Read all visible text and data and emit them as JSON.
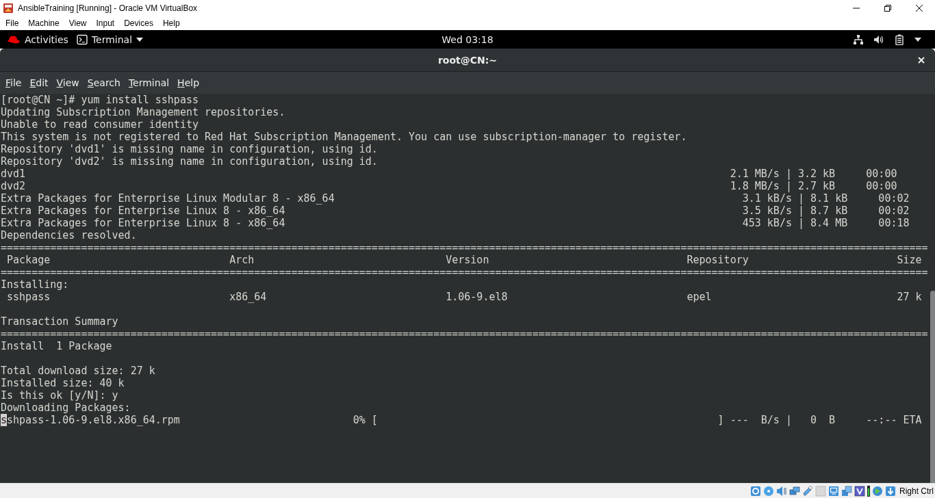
{
  "vm_window": {
    "title": "AnsibleTraining [Running] - Oracle VM VirtualBox",
    "menu": [
      "File",
      "Machine",
      "View",
      "Input",
      "Devices",
      "Help"
    ]
  },
  "top_bar": {
    "activities": "Activities",
    "app_menu": "Terminal",
    "clock": "Wed 03:18"
  },
  "terminal": {
    "title": "root@CN:~",
    "menu": [
      "File",
      "Edit",
      "View",
      "Search",
      "Terminal",
      "Help"
    ],
    "lines": [
      {
        "kind": "text",
        "text": "[root@CN ~]# yum install sshpass",
        "cursor": false
      },
      {
        "kind": "text",
        "text": "Updating Subscription Management repositories.",
        "cursor": false
      },
      {
        "kind": "text",
        "text": "Unable to read consumer identity",
        "cursor": false
      },
      {
        "kind": "text",
        "text": "This system is not registered to Red Hat Subscription Management. You can use subscription-manager to register.",
        "cursor": false
      },
      {
        "kind": "text",
        "text": "Repository 'dvd1' is missing name in configuration, using id.",
        "cursor": false
      },
      {
        "kind": "text",
        "text": "Repository 'dvd2' is missing name in configuration, using id.",
        "cursor": false
      },
      {
        "kind": "text",
        "text": "dvd1                                                                                                                  2.1 MB/s | 3.2 kB     00:00",
        "cursor": false
      },
      {
        "kind": "text",
        "text": "dvd2                                                                                                                  1.8 MB/s | 2.7 kB     00:00",
        "cursor": false
      },
      {
        "kind": "text",
        "text": "Extra Packages for Enterprise Linux Modular 8 - x86_64                                                                  3.1 kB/s | 8.1 kB     00:02",
        "cursor": false
      },
      {
        "kind": "text",
        "text": "Extra Packages for Enterprise Linux 8 - x86_64                                                                          3.5 kB/s | 8.7 kB     00:02",
        "cursor": false
      },
      {
        "kind": "text",
        "text": "Extra Packages for Enterprise Linux 8 - x86_64                                                                          453 kB/s | 8.4 MB     00:18",
        "cursor": false
      },
      {
        "kind": "text",
        "text": "Dependencies resolved.",
        "cursor": false
      },
      {
        "kind": "text",
        "text": "======================================================================================================================================================",
        "cursor": false
      },
      {
        "kind": "text",
        "text": " Package                             Arch                               Version                                Repository                        Size",
        "cursor": false
      },
      {
        "kind": "text",
        "text": "======================================================================================================================================================",
        "cursor": false
      },
      {
        "kind": "text",
        "text": "Installing:",
        "cursor": false
      },
      {
        "kind": "text",
        "text": " sshpass                             x86_64                             1.06-9.el8                             epel                              27 k",
        "cursor": false
      },
      {
        "kind": "blank",
        "cursor": false
      },
      {
        "kind": "text",
        "text": "Transaction Summary",
        "cursor": false
      },
      {
        "kind": "text",
        "text": "======================================================================================================================================================",
        "cursor": false
      },
      {
        "kind": "text",
        "text": "Install  1 Package",
        "cursor": false
      },
      {
        "kind": "blank",
        "cursor": false
      },
      {
        "kind": "text",
        "text": "Total download size: 27 k",
        "cursor": false
      },
      {
        "kind": "text",
        "text": "Installed size: 40 k",
        "cursor": false
      },
      {
        "kind": "text",
        "text": "Is this ok [y/N]: y",
        "cursor": false
      },
      {
        "kind": "text",
        "text": "Downloading Packages:",
        "cursor": false
      },
      {
        "kind": "text",
        "text": "sshpass-1.06-9.el8.x86_64.rpm                            0% [                                                       ] ---  B/s |   0  B     --:-- ETA",
        "cursor": true
      }
    ]
  },
  "status_bar": {
    "host_key": "Right Ctrl"
  }
}
